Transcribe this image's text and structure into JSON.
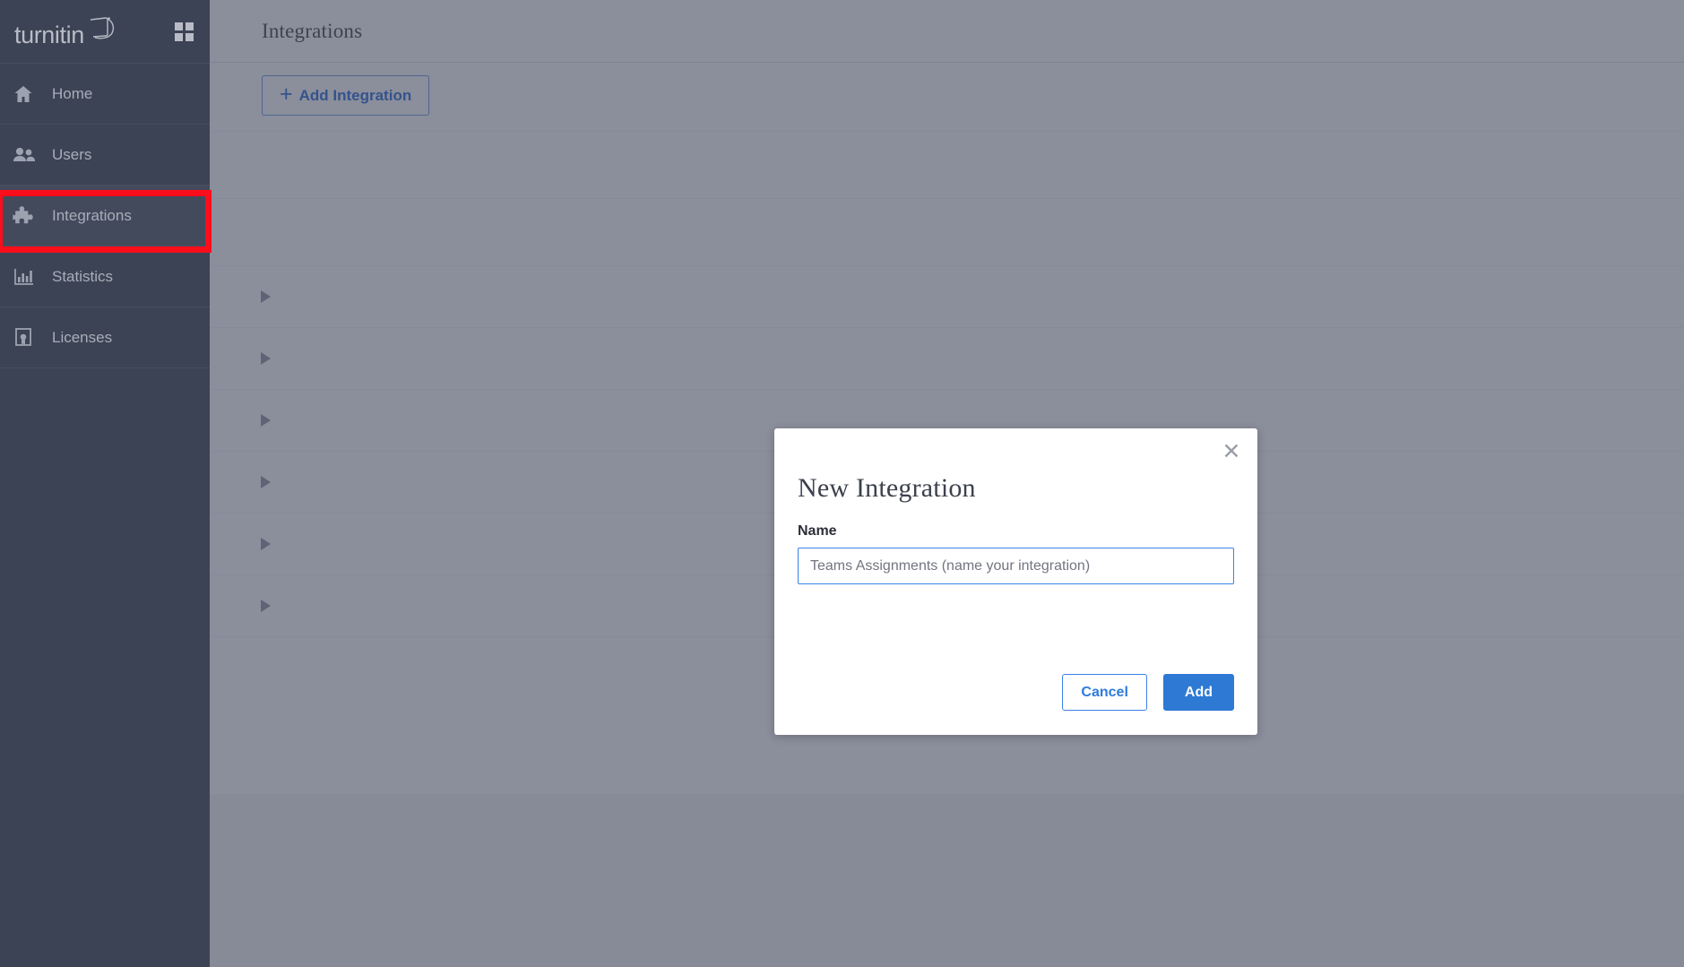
{
  "brand": {
    "name": "turnitin",
    "apps_icon": "grid-apps-icon",
    "logo_mark": "turnitin-swoosh-icon"
  },
  "sidebar": {
    "items": [
      {
        "label": "Home",
        "icon": "home-icon",
        "active": false
      },
      {
        "label": "Users",
        "icon": "users-icon",
        "active": false
      },
      {
        "label": "Integrations",
        "icon": "puzzle-piece-icon",
        "active": true
      },
      {
        "label": "Statistics",
        "icon": "bar-chart-icon",
        "active": false
      },
      {
        "label": "Licenses",
        "icon": "certificate-icon",
        "active": false
      }
    ],
    "highlight_color": "#fc0d1b",
    "background_color": "#3c4354",
    "active_background_color": "#434a5c"
  },
  "header": {
    "title": "Integrations"
  },
  "toolbar": {
    "add_integration_label": "Add Integration",
    "add_integration_icon": "plus-icon"
  },
  "list": {
    "rows": [
      {
        "caret": false,
        "caret_icon": ""
      },
      {
        "caret": false,
        "caret_icon": ""
      },
      {
        "caret": true,
        "caret_icon": "caret-right-icon"
      },
      {
        "caret": true,
        "caret_icon": "caret-right-icon"
      },
      {
        "caret": true,
        "caret_icon": "caret-right-icon"
      },
      {
        "caret": true,
        "caret_icon": "caret-right-icon"
      },
      {
        "caret": true,
        "caret_icon": "caret-right-icon"
      },
      {
        "caret": true,
        "caret_icon": "caret-right-icon"
      }
    ]
  },
  "modal": {
    "title": "New Integration",
    "close_icon": "close-x-icon",
    "name_label": "Name",
    "name_value": "",
    "name_placeholder": "Teams Assignments (name your integration)",
    "cancel_label": "Cancel",
    "add_label": "Add",
    "primary_color": "#2d79d4",
    "border_color": "#3b82e8"
  }
}
